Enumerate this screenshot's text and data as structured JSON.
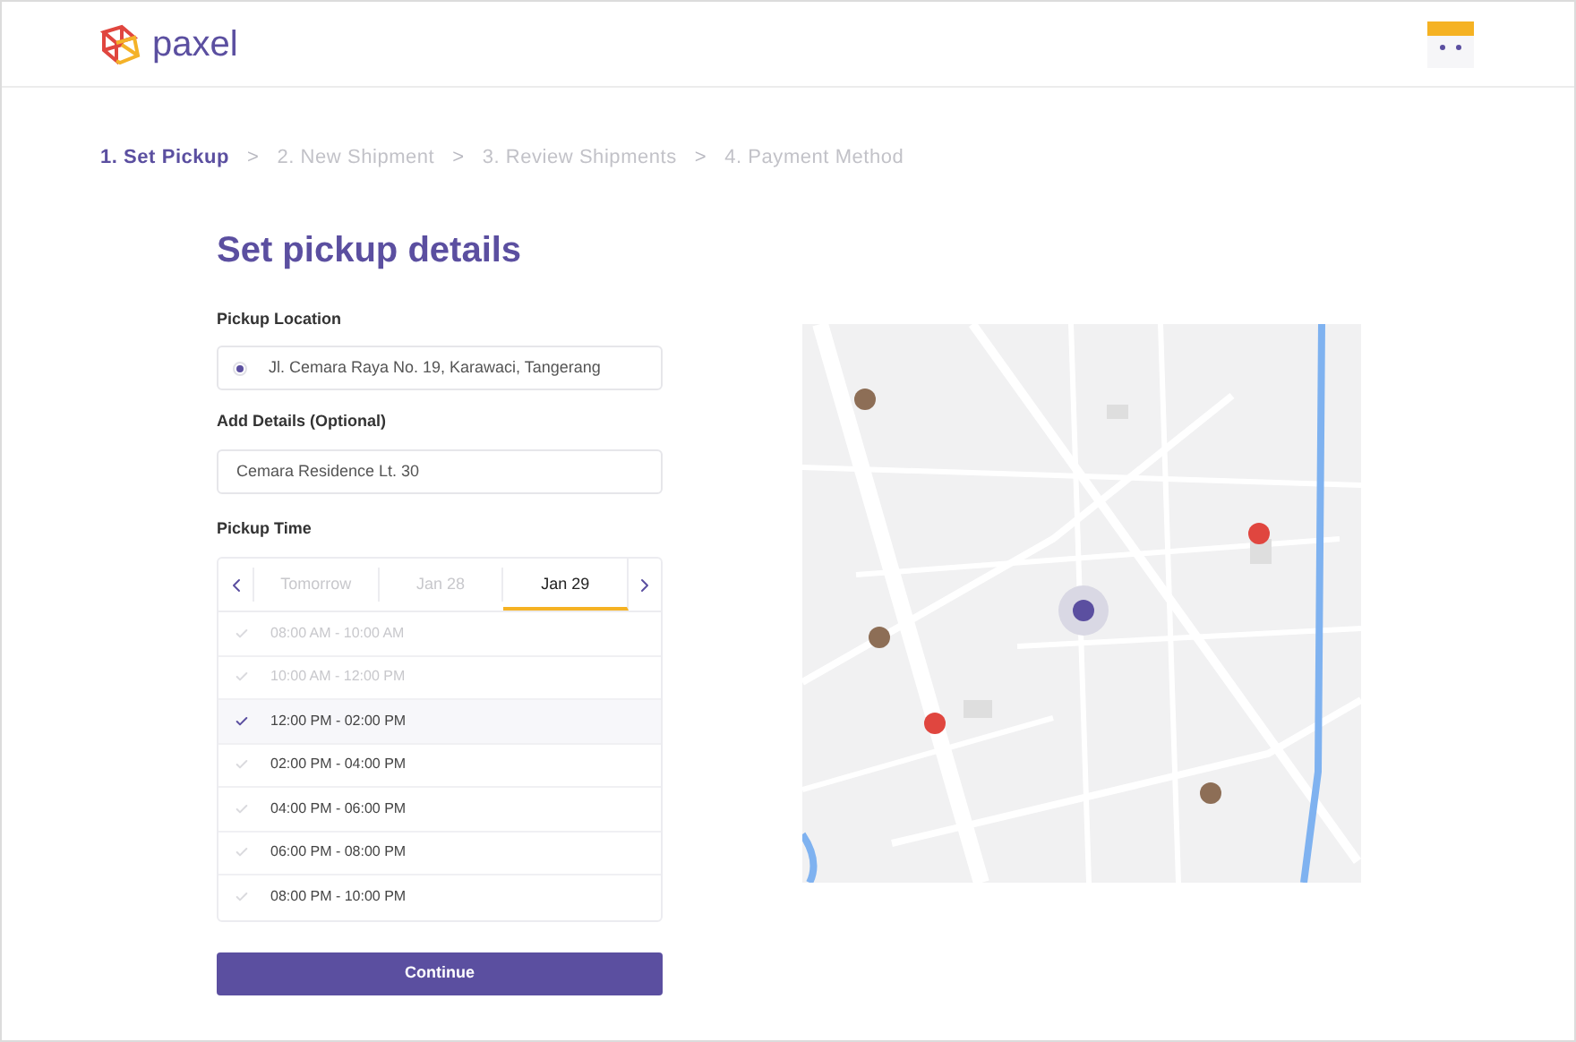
{
  "header": {
    "brand": "paxel"
  },
  "steps": [
    {
      "label": "1. Set Pickup",
      "selected": true
    },
    {
      "label": "2. New Shipment",
      "selected": false
    },
    {
      "label": "3. Review Shipments",
      "selected": false
    },
    {
      "label": "4. Payment Method",
      "selected": false
    }
  ],
  "step_separator": ">",
  "title": "Set pickup details",
  "pickup_location": {
    "label": "Pickup Location",
    "value": "Jl. Cemara Raya No. 19, Karawaci, Tangerang",
    "selected": true
  },
  "details": {
    "label": "Add Details (Optional)",
    "value": "Cemara Residence Lt. 30"
  },
  "pickup_time": {
    "label": "Pickup Time",
    "days": [
      {
        "label": "Tomorrow",
        "selected": false
      },
      {
        "label": "Jan 28",
        "selected": false
      },
      {
        "label": "Jan 29",
        "selected": true
      }
    ],
    "slots": [
      {
        "label": "08:00 AM - 10:00 AM",
        "disabled": true,
        "selected": false
      },
      {
        "label": "10:00 AM - 12:00 PM",
        "disabled": true,
        "selected": false
      },
      {
        "label": "12:00 PM - 02:00 PM",
        "disabled": false,
        "selected": true
      },
      {
        "label": "02:00 PM - 04:00 PM",
        "disabled": false,
        "selected": false
      },
      {
        "label": "04:00 PM - 06:00 PM",
        "disabled": false,
        "selected": false
      },
      {
        "label": "06:00 PM - 08:00 PM",
        "disabled": false,
        "selected": false
      },
      {
        "label": "08:00 PM - 10:00 PM",
        "disabled": false,
        "selected": false
      }
    ]
  },
  "continue_button": "Continue"
}
